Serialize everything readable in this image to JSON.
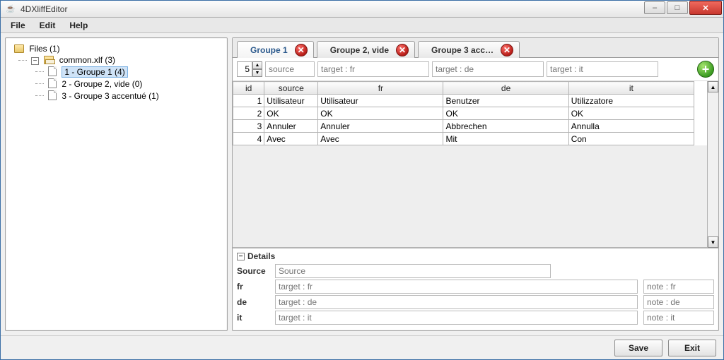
{
  "window": {
    "title": "4DXliffEditor"
  },
  "menubar": [
    "File",
    "Edit",
    "Help"
  ],
  "tree": {
    "root": {
      "label": "Files (1)"
    },
    "file": {
      "label": "common.xlf (3)"
    },
    "groups": [
      {
        "label": "1 - Groupe 1 (4)",
        "selected": true
      },
      {
        "label": "2 - Groupe 2, vide (0)",
        "selected": false
      },
      {
        "label": "3 - Groupe 3 accentué (1)",
        "selected": false
      }
    ]
  },
  "tabs": [
    {
      "label": "Groupe 1",
      "active": true
    },
    {
      "label": "Groupe 2, vide",
      "active": false
    },
    {
      "label": "Groupe 3 acc…",
      "active": false
    }
  ],
  "filter": {
    "next_id": "5",
    "placeholders": {
      "source": "source",
      "fr": "target : fr",
      "de": "target : de",
      "it": "target : it"
    }
  },
  "table": {
    "headers": {
      "id": "id",
      "source": "source",
      "fr": "fr",
      "de": "de",
      "it": "it"
    },
    "rows": [
      {
        "id": "1",
        "source": "Utilisateur",
        "fr": "Utilisateur",
        "de": "Benutzer",
        "it": "Utilizzatore"
      },
      {
        "id": "2",
        "source": "OK",
        "fr": "OK",
        "de": "OK",
        "it": "OK"
      },
      {
        "id": "3",
        "source": "Annuler",
        "fr": "Annuler",
        "de": "Abbrechen",
        "it": "Annulla"
      },
      {
        "id": "4",
        "source": "Avec",
        "fr": "Avec",
        "de": "Mit",
        "it": "Con"
      }
    ]
  },
  "details": {
    "header": "Details",
    "labels": {
      "source": "Source",
      "fr": "fr",
      "de": "de",
      "it": "it"
    },
    "placeholders": {
      "source": "Source",
      "target_fr": "target : fr",
      "note_fr": "note : fr",
      "target_de": "target : de",
      "note_de": "note : de",
      "target_it": "target : it",
      "note_it": "note : it"
    }
  },
  "footer": {
    "save": "Save",
    "exit": "Exit"
  }
}
